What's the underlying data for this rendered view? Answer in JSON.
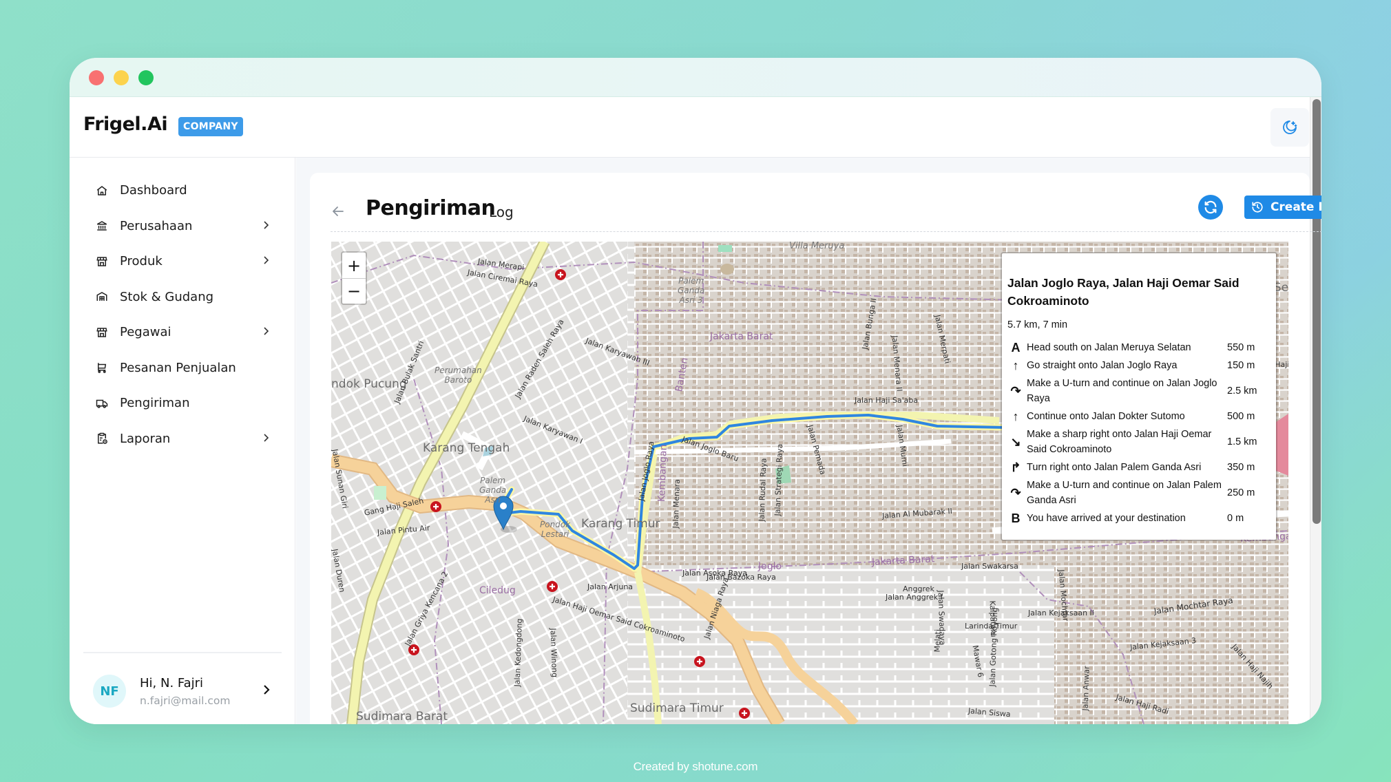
{
  "window": {
    "controls": [
      "close",
      "minimize",
      "maximize"
    ]
  },
  "header": {
    "logo": "Frigel.Ai",
    "badge": "COMPANY",
    "theme_toggle_icon": "moon-stars-icon"
  },
  "sidebar": {
    "items": [
      {
        "label": "Dashboard",
        "icon": "home-icon",
        "has_children": false
      },
      {
        "label": "Perusahaan",
        "icon": "bank-icon",
        "has_children": true
      },
      {
        "label": "Produk",
        "icon": "store-icon",
        "has_children": true
      },
      {
        "label": "Stok & Gudang",
        "icon": "warehouse-icon",
        "has_children": false
      },
      {
        "label": "Pegawai",
        "icon": "store-icon",
        "has_children": true
      },
      {
        "label": "Pesanan Penjualan",
        "icon": "cart-icon",
        "has_children": false
      },
      {
        "label": "Pengiriman",
        "icon": "truck-icon",
        "has_children": false
      },
      {
        "label": "Laporan",
        "icon": "report-icon",
        "has_children": true
      }
    ],
    "user": {
      "initials": "NF",
      "greeting": "Hi, N. Fajri",
      "email": "n.fajri@mail.com"
    }
  },
  "page": {
    "title": "Pengiriman",
    "subtitle": "Log",
    "refresh_icon": "refresh-icon",
    "create_button": "Create Log"
  },
  "map": {
    "zoom_in": "+",
    "zoom_out": "−",
    "labels": {
      "villa_meruya": "Villa Meruya",
      "meruya": "Meruya Se",
      "jakarta_barat_1": "Jakarta Barat",
      "jakarta_barat_2": "Jakarta Barat",
      "karang_tengah": "Karang Tengah",
      "karang_timur": "Karang Timur",
      "pondok_pucung": "ndok Pucung",
      "sudimara_barat": "Sudimara Barat",
      "sudimara_timur": "Sudimara Timur",
      "ciledug": "Ciledug",
      "joglo": "Joglo",
      "kembangan": "Kembangan",
      "kembangan_v": "Kembangan",
      "banten": "Banten",
      "perumahan": "Perumahan\nBaroto",
      "palem_ganda": "Palem\nGanda\nAsri",
      "palem_ganda3": "Palem\nGanda\nAsri 3",
      "pondok_lestari": "Pondok\nLestari",
      "jl_merapi": "Jalan Merapi",
      "jl_ciremai": "Jalan Ciremai Raya",
      "jl_raden_saleh": "Jalan Raden Saleh Raya",
      "jl_karyawan3": "Jalan Karyawan III",
      "jl_karyawan1": "Jalan Karyawan I",
      "jl_bulak_santri": "Jalan Bulak Santri",
      "jl_sunan_giri": "Jalan Sunan Giri",
      "gang_haji_saleh": "Gang Haji Saleh",
      "jl_pintu_air": "Jalan Pintu Air",
      "jl_duren": "Jalan Duren",
      "jl_arjuna": "Jalan Arjuna",
      "jl_asoka": "Jalan Asoka Raya",
      "jl_menara": "Jalan Menara",
      "jl_hos": "Jalan Haji Oemar Said Cokroaminoto",
      "jl_griya": "Jalan Griya Kencana 2",
      "jl_kedongdong": "Jalan Kedongdong",
      "jl_winong": "Jalan Winong",
      "jl_niaga": "Jalan Niaga Raya",
      "jl_joglo_baru": "Jalan Joglo Baru",
      "jl_joglo_raya": "Jalan Joglo Raya",
      "jl_haji_saaba": "Jalan Haji Sa'aba",
      "jl_bunga": "Jalan Bunga II",
      "jl_menara2": "Jalan Menara II",
      "jl_murni": "Jalan Murni",
      "jl_merpati": "Jalan Merpati",
      "jl_pemada": "Jalan Pemada",
      "jl_al_mubarak": "Jalan Al Mubarak II",
      "jl_rudal": "Jalan Rudal Raya",
      "jl_strategi": "Jalan Strategi Raya",
      "jl_bazoka": "Jalan Bazoka Raya",
      "jl_swakarsa": "Jalan Swakarsa",
      "jl_anggrek": "Jalan Anggrek I",
      "anggrek": "Anggrek",
      "jl_swadaya": "Jalan Swadaya",
      "jl_kejaksaan2": "Jalan Kejaksaan II",
      "jl_kejaksaan3": "Jalan Kejaksaan 3",
      "jl_mochtar_raya": "Jalan Mochtar Raya",
      "jl_mochtar": "Jalan Mochtar",
      "larinda": "Larinda Timur",
      "jl_gotong": "Jalan Gotong Royong",
      "jl_haji_radi": "Jalan Haji Radi",
      "jl_haji_najih": "Jalan Haji Najih",
      "jl_siswa": "Jalan Siswa",
      "jl_anwar": "Jalan Anwar",
      "melati": "Melati",
      "mawar": "Mawar 6",
      "kalpataru": "Kalpataru",
      "jl_hajih": "Jalan Haji"
    },
    "route": {
      "title": "Jalan Joglo Raya, Jalan Haji Oemar Said Cokroaminoto",
      "summary": "5.7 km, 7 min",
      "steps": [
        {
          "icon": "A",
          "icon_name": "start-marker-icon",
          "text": "Head south on Jalan Meruya Selatan",
          "distance": "550 m"
        },
        {
          "icon": "↑",
          "icon_name": "straight-arrow-icon",
          "text": "Go straight onto Jalan Joglo Raya",
          "distance": "150 m"
        },
        {
          "icon": "↷",
          "icon_name": "u-turn-icon",
          "text": "Make a U-turn and continue on Jalan Joglo Raya",
          "distance": "2.5 km"
        },
        {
          "icon": "↑",
          "icon_name": "straight-arrow-icon",
          "text": "Continue onto Jalan Dokter Sutomo",
          "distance": "500 m"
        },
        {
          "icon": "↘",
          "icon_name": "sharp-right-icon",
          "text": "Make a sharp right onto Jalan Haji Oemar Said Cokroaminoto",
          "distance": "1.5 km"
        },
        {
          "icon": "↱",
          "icon_name": "turn-right-icon",
          "text": "Turn right onto Jalan Palem Ganda Asri",
          "distance": "350 m"
        },
        {
          "icon": "↷",
          "icon_name": "u-turn-icon",
          "text": "Make a U-turn and continue on Jalan Palem Ganda Asri",
          "distance": "250 m"
        },
        {
          "icon": "B",
          "icon_name": "end-marker-icon",
          "text": "You have arrived at your destination",
          "distance": "0 m"
        }
      ]
    },
    "colors": {
      "route": "#2f86e0",
      "primary_road": "#f6d29a",
      "secondary_road": "#f3f4b0",
      "land": "#e0dfdd",
      "buildings": "#c7b8ab",
      "admin_boundary": "#a885b5",
      "hospital": "#c8141e"
    }
  },
  "footer": {
    "credit": "Created by shotune.com"
  }
}
